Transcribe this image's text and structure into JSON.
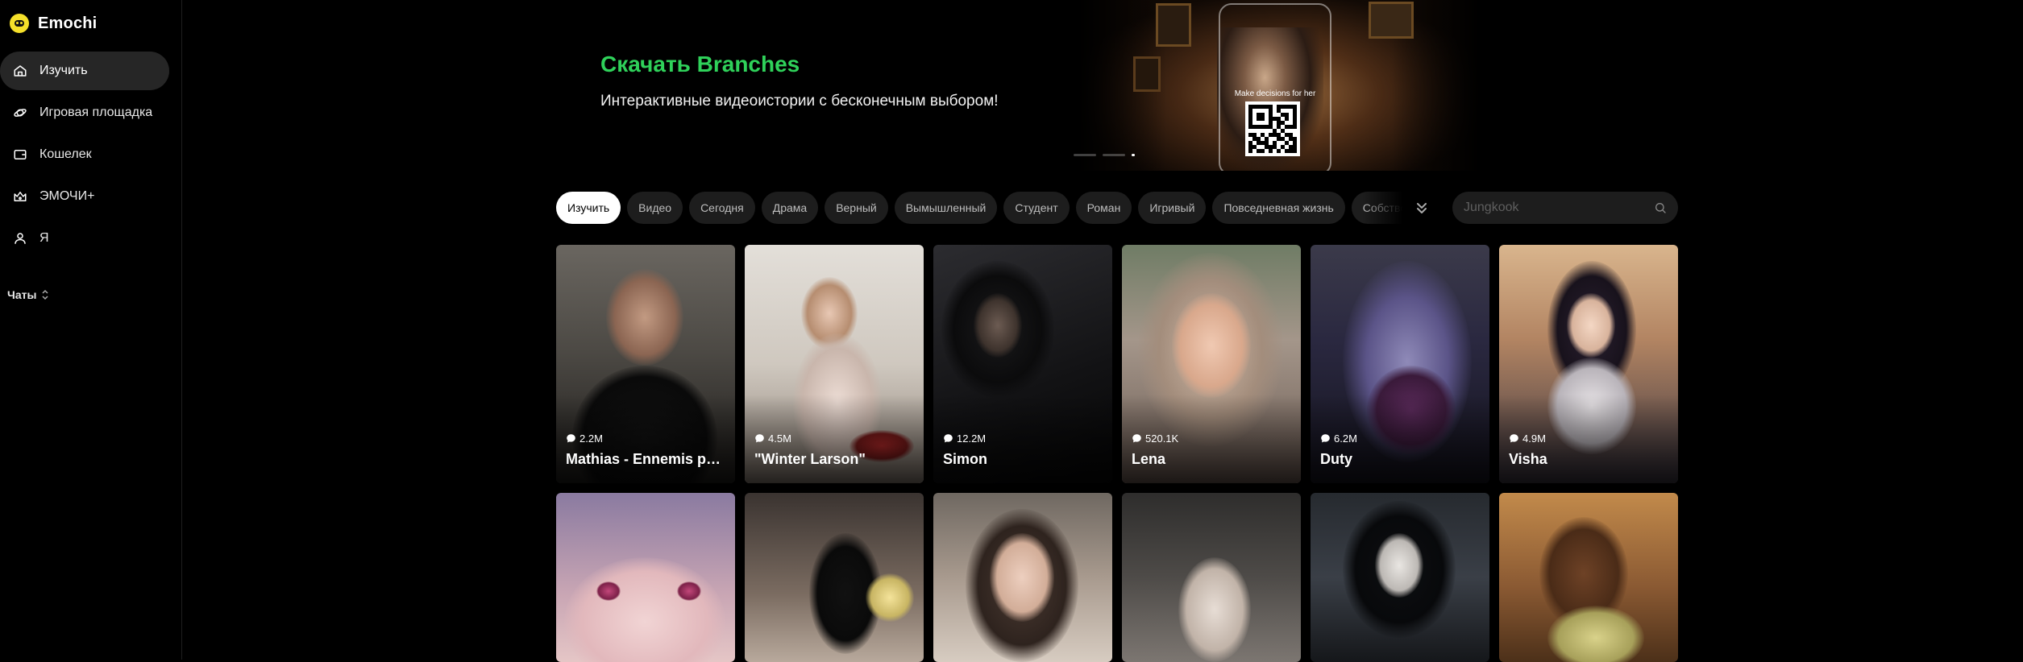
{
  "brand": {
    "name": "Emochi"
  },
  "sidebar": {
    "items": [
      {
        "label": "Изучить",
        "icon": "home-icon",
        "active": true
      },
      {
        "label": "Игровая площадка",
        "icon": "planet-icon",
        "active": false
      },
      {
        "label": "Кошелек",
        "icon": "wallet-icon",
        "active": false
      },
      {
        "label": "ЭМОЧИ+",
        "icon": "crown-icon",
        "active": false
      },
      {
        "label": "Я",
        "icon": "user-icon",
        "active": false
      }
    ],
    "chats_label": "Чаты"
  },
  "banner": {
    "title": "Скачать Branches",
    "subtitle": "Интерактивные видеоистории с бесконечным выбором!",
    "image_caption": "Make decisions for her",
    "slides_total": 3,
    "slide_active": 3
  },
  "tabs": [
    "Изучить",
    "Видео",
    "Сегодня",
    "Драма",
    "Верный",
    "Вымышленный",
    "Студент",
    "Роман",
    "Игривый",
    "Повседневная жизнь",
    "Собственник"
  ],
  "active_tab": "Изучить",
  "search": {
    "placeholder": "Jungkook",
    "value": ""
  },
  "cards_row1": [
    {
      "name": "Mathias - Ennemis po...",
      "stat": "2.2M"
    },
    {
      "name": "\"Winter Larson\"",
      "stat": "4.5M"
    },
    {
      "name": "Simon",
      "stat": "12.2M"
    },
    {
      "name": "Lena",
      "stat": "520.1K"
    },
    {
      "name": "Duty",
      "stat": "6.2M"
    },
    {
      "name": "Visha",
      "stat": "4.9M"
    }
  ],
  "colors": {
    "accent_green": "#2fd15a",
    "logo_yellow": "#f5e02a",
    "active_nav": "#262626",
    "chip_bg": "#1d1d1d"
  }
}
